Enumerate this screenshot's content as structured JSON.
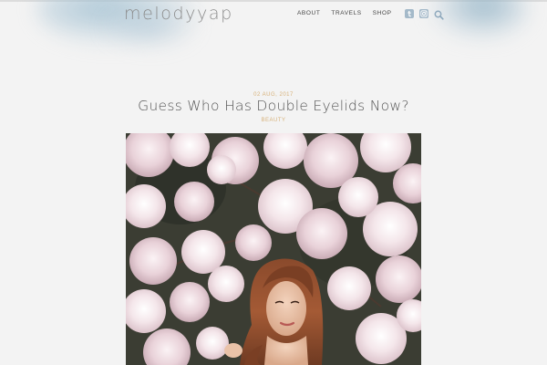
{
  "site": {
    "logo_text": "melodyyap",
    "accent_color": "#d7b27b",
    "icon_color": "#a4b9c9"
  },
  "nav": {
    "items": [
      {
        "label": "ABOUT"
      },
      {
        "label": "TRAVELS"
      },
      {
        "label": "SHOP"
      }
    ],
    "social_icons": [
      "tumblr-icon",
      "instagram-icon"
    ],
    "search_icon": "search-icon"
  },
  "post": {
    "date": "02 AUG, 2017",
    "title": "Guess Who Has Double Eyelids Now?",
    "category": "BEAUTY"
  }
}
